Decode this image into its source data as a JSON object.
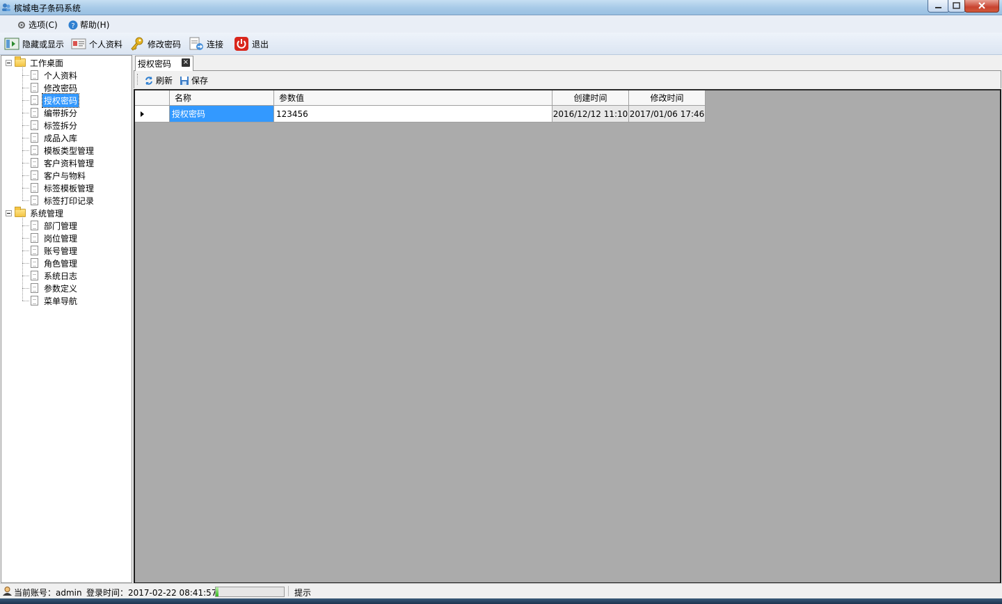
{
  "window": {
    "title": "槟城电子条码系统"
  },
  "menu": [
    {
      "label": "选项(C)",
      "icon": "gear-icon"
    },
    {
      "label": "帮助(H)",
      "icon": "help-icon"
    }
  ],
  "toolbar": [
    {
      "label": "隐藏或显示",
      "icon": "toggle-panel-icon"
    },
    {
      "label": "个人资料",
      "icon": "id-card-icon"
    },
    {
      "label": "修改密码",
      "icon": "key-icon"
    },
    {
      "label": "连接",
      "icon": "connect-icon"
    },
    {
      "label": "退出",
      "icon": "power-icon"
    }
  ],
  "tree": {
    "groups": [
      {
        "label": "工作桌面",
        "items": [
          "个人资料",
          "修改密码",
          "授权密码",
          "编带拆分",
          "标签拆分",
          "成品入库",
          "模板类型管理",
          "客户资料管理",
          "客户与物料",
          "标签模板管理",
          "标签打印记录"
        ]
      },
      {
        "label": "系统管理",
        "items": [
          "部门管理",
          "岗位管理",
          "账号管理",
          "角色管理",
          "系统日志",
          "参数定义",
          "菜单导航"
        ]
      }
    ],
    "selected": "授权密码"
  },
  "tab": {
    "label": "授权密码",
    "close": "×"
  },
  "subtoolbar": [
    {
      "label": "刷新",
      "icon": "refresh-icon"
    },
    {
      "label": "保存",
      "icon": "save-icon"
    }
  ],
  "grid": {
    "columns": [
      "名称",
      "参数值",
      "创建时间",
      "修改时间"
    ],
    "rows": [
      {
        "name": "授权密码",
        "value": "123456",
        "created": "2016/12/12 11:10",
        "modified": "2017/01/06 17:46"
      }
    ]
  },
  "status": {
    "account": "当前账号：admin",
    "login": "登录时间：2017-02-22 08:41:57",
    "progress": 0.04,
    "hint": "提示"
  },
  "colors": {
    "selection": "#3399ff",
    "grid_bg": "#ababab",
    "titlebar": "#a9cbe8"
  }
}
